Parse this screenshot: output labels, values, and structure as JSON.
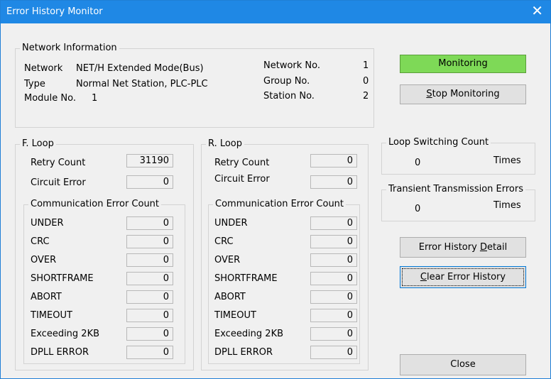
{
  "window": {
    "title": "Error History Monitor",
    "close_glyph": "✕"
  },
  "network_info": {
    "group_label": "Network Information",
    "network_label": "Network",
    "network_value": "NET/H Extended Mode(Bus)",
    "type_label": "Type",
    "type_value": "Normal Net Station, PLC-PLC",
    "module_label": "Module No.",
    "module_value": "1",
    "network_no_label": "Network No.",
    "network_no_value": "1",
    "group_no_label": "Group No.",
    "group_no_value": "0",
    "station_no_label": "Station No.",
    "station_no_value": "2"
  },
  "status": {
    "label": "Monitoring",
    "color": "#7ed957"
  },
  "buttons": {
    "stop": {
      "prefix": "",
      "key": "S",
      "rest": "top Monitoring"
    },
    "detail": {
      "prefix": "Error History ",
      "key": "D",
      "rest": "etail"
    },
    "clear": {
      "prefix": "",
      "key": "C",
      "rest": "lear Error History"
    },
    "close": {
      "label": "Close"
    }
  },
  "f_loop": {
    "label": "F. Loop",
    "retry_label": "Retry Count",
    "retry_value": "31190",
    "circuit_label": "Circuit Error",
    "circuit_value": "0",
    "comm_label": "Communication Error Count",
    "errors": [
      {
        "label": "UNDER",
        "value": "0"
      },
      {
        "label": "CRC",
        "value": "0"
      },
      {
        "label": "OVER",
        "value": "0"
      },
      {
        "label": "SHORTFRAME",
        "value": "0"
      },
      {
        "label": "ABORT",
        "value": "0"
      },
      {
        "label": "TIMEOUT",
        "value": "0"
      },
      {
        "label": "Exceeding 2KB",
        "value": "0"
      },
      {
        "label": "DPLL ERROR",
        "value": "0"
      }
    ]
  },
  "r_loop": {
    "label": "R. Loop",
    "retry_label": "Retry Count",
    "retry_value": "0",
    "circuit_label": "Circuit Error",
    "circuit_value": "0",
    "comm_label": "Communication Error Count",
    "errors": [
      {
        "label": "UNDER",
        "value": "0"
      },
      {
        "label": "CRC",
        "value": "0"
      },
      {
        "label": "OVER",
        "value": "0"
      },
      {
        "label": "SHORTFRAME",
        "value": "0"
      },
      {
        "label": "ABORT",
        "value": "0"
      },
      {
        "label": "TIMEOUT",
        "value": "0"
      },
      {
        "label": "Exceeding 2KB",
        "value": "0"
      },
      {
        "label": "DPLL ERROR",
        "value": "0"
      }
    ]
  },
  "loop_switching": {
    "label": "Loop Switching Count",
    "value": "0",
    "unit": "Times"
  },
  "transient": {
    "label": "Transient Transmission Errors",
    "value": "0",
    "unit": "Times"
  }
}
